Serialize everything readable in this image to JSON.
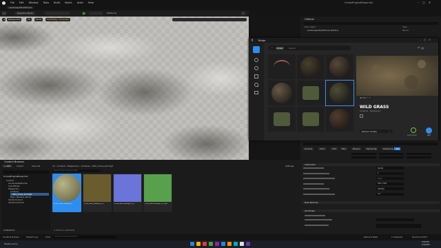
{
  "window": {
    "project": "LandscapeToolTutorial",
    "menu": [
      "File",
      "Edit",
      "Window",
      "Tools",
      "Build",
      "Select",
      "Actor",
      "Help"
    ],
    "project_name": "UnrealEngineBlueprints",
    "mode": "Selection Mode",
    "platforms": "Platforms"
  },
  "viewport": {
    "perspective": "Perspective",
    "lit": "Lit",
    "show": "Show",
    "scalability": "Scalability: Cinematic"
  },
  "outliner": {
    "title": "Outliner",
    "col_label": "Item Label",
    "col_type": "Type",
    "row": "LandscapeToolTutorial (Editor)",
    "row_type": "World"
  },
  "bridge": {
    "title": "Bridge",
    "search_chip": "Grass",
    "search_placeholder": "Search",
    "asset_name": "WILD GRASS",
    "asset_sub": "Surfaces · Weathered",
    "render_label": "Render 1 / 4",
    "quality": "Medium Quality",
    "downloaded": "Downloaded",
    "add": "Add",
    "colors": {
      "accent": "#2d8ef0",
      "selected": "#3a8ee6",
      "ok": "#7cc24a"
    }
  },
  "content_browser": {
    "tab": "Content Browser",
    "add": "+ Add",
    "import": "Import",
    "save_all": "Save All",
    "path": [
      "All",
      "Content",
      "Megascans",
      "Surfaces",
      "Wild_Grass_sbmalgf"
    ],
    "settings": "Settings",
    "search_placeholder": "Search Wild_Grass_sbmalgf",
    "tree_root": "UnrealEngineBlueprints",
    "tree": [
      "Content",
      "LandscapeMaterials",
      "CloudModel",
      "Megascans",
      "Surfaces",
      "Wild_Grass_sbmalgf",
      "Basic_Meadow_Plants",
      "StarterContent",
      "StarterContent2"
    ],
    "assets": [
      {
        "name": "MI_Wild_Grass_sbmalgf_2K",
        "color": "#7d7a52"
      },
      {
        "name": "T_Wild_Grass_sbmalgf_2K_D",
        "color": "#6b5c2f"
      },
      {
        "name": "T_Wild_Grass_sbmalgf_2K_N",
        "color": "#6b74d8"
      },
      {
        "name": "T_Wild_Grass_sbmalgf_2K_ORDp",
        "color": "#58a04c"
      }
    ],
    "status": "4 items (1 selected)",
    "collections": "Collections"
  },
  "details": {
    "tabs": [
      "General",
      "Actor",
      "LOD",
      "Misc",
      "Physics",
      "Rendering",
      "Streaming",
      "All"
    ],
    "sections": [
      "Information",
      "Build Particles",
      "Landscape"
    ],
    "values": [
      "64x64",
      "1",
      "7 x 7",
      "505 x 505",
      "255025",
      "1.0"
    ]
  },
  "statusbar": {
    "drawer": "Content Drawer",
    "log": "Output Log",
    "cmd": "Cmd",
    "cmd_placeholder": "Enter Console Command",
    "derived": "Derived Data",
    "unsaved": "1 Unsaved",
    "source": "Source Control"
  },
  "taskbar": {
    "weather": "Mostly sunny",
    "time": "2:00 PM",
    "date": "1/3/2023"
  }
}
